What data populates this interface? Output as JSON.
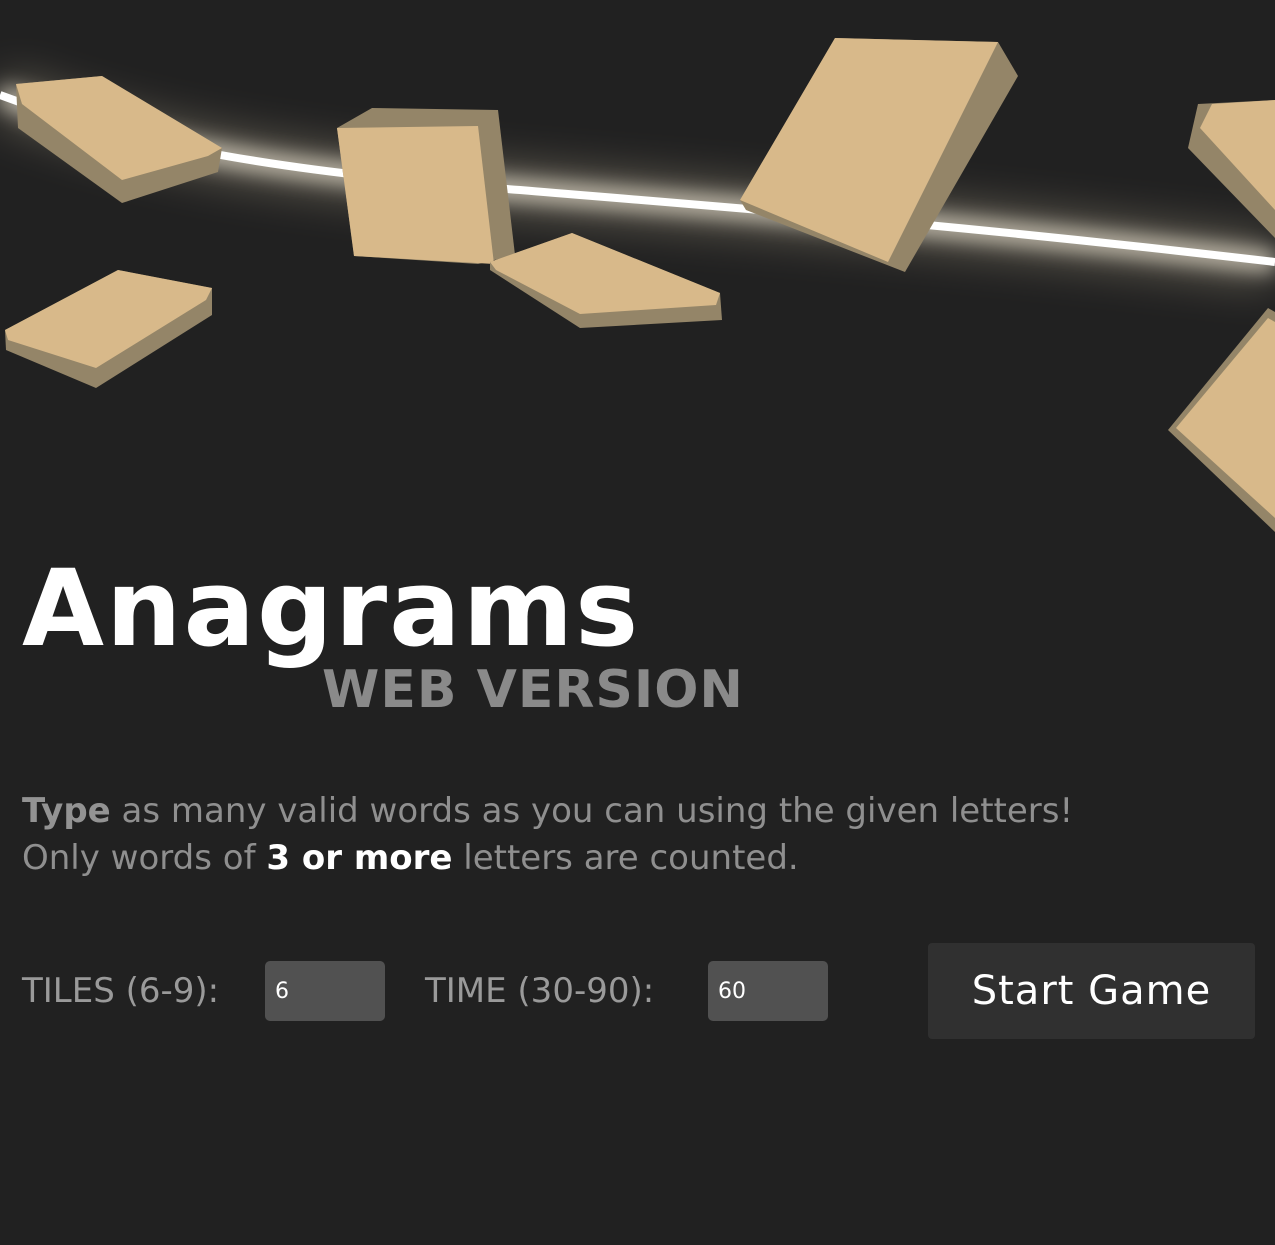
{
  "app": {
    "title": "Anagrams",
    "subtitle": "WEB VERSION"
  },
  "instructions": {
    "line1_emphasis": "Type",
    "line1_rest": " as many valid words as you can using the given letters!",
    "line2_prefix": "Only words of ",
    "line2_emphasis": "3 or more",
    "line2_suffix": " letters are counted."
  },
  "settings": {
    "tiles": {
      "label": "TILES (6-9):",
      "value": "6"
    },
    "time": {
      "label": "TIME (30-90):",
      "value": "60"
    }
  },
  "actions": {
    "start_label": "Start Game"
  },
  "colors": {
    "background": "#212121",
    "tile_face": "#d8b98a",
    "tile_side": "#9b8968",
    "glow": "#ffffff"
  },
  "hero_icons": [
    "light-streak-icon",
    "letter-tile-icon"
  ]
}
